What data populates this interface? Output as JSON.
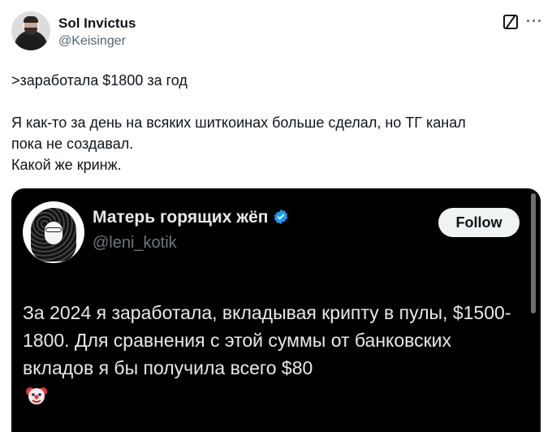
{
  "author": {
    "name": "Sol Invictus",
    "handle": "@Keisinger"
  },
  "icons": {
    "grok": "grok-icon",
    "more": "more-horizontal-icon"
  },
  "more_glyph": "···",
  "tweet": {
    "line1": ">заработала $1800 за год",
    "line2": "Я как-то за день на всяких шиткоинах больше сделал, но ТГ канал",
    "line3": "пока не создавал.",
    "line4": "Какой же кринж."
  },
  "quoted": {
    "name": "Матерь горящих жёп",
    "handle": "@leni_kotik",
    "follow_label": "Follow",
    "text": "За 2024 я заработала, вкладывая крипту в пулы, $1500-1800. Для сравнения с этой суммы от банковских вкладов я бы получила всего $80",
    "emoji": "clown-face-icon",
    "verified_color": "#1d9bf0"
  }
}
